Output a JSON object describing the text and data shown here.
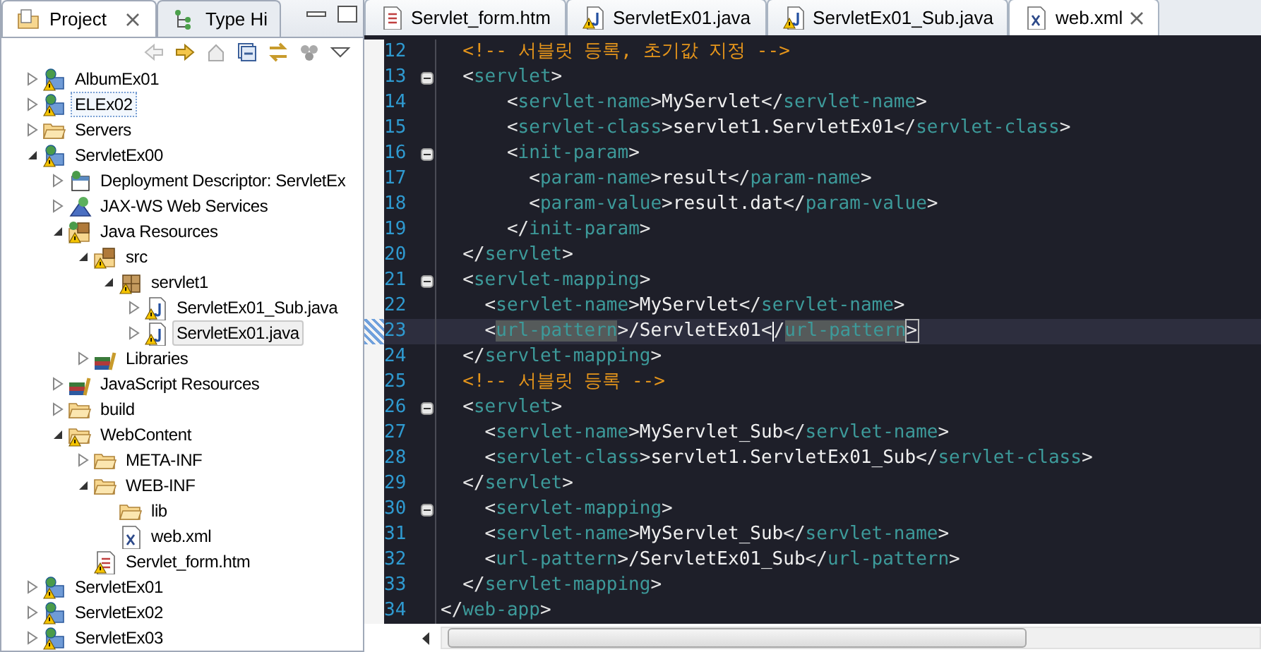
{
  "left_panel": {
    "tabs": [
      {
        "label": "Project",
        "selected": true
      },
      {
        "label": "Type Hi",
        "selected": false
      }
    ],
    "tree": [
      {
        "label": "AlbumEx01",
        "kind": "project",
        "warning": true,
        "expanded": false,
        "selected": false
      },
      {
        "label": "ELEx02",
        "kind": "project",
        "warning": true,
        "expanded": false,
        "selected": false,
        "focused": true
      },
      {
        "label": "Servers",
        "kind": "folder",
        "warning": false,
        "expanded": false,
        "selected": false
      },
      {
        "label": "ServletEx00",
        "kind": "project",
        "warning": true,
        "expanded": true,
        "selected": false,
        "children": [
          {
            "label": "Deployment Descriptor: ServletEx",
            "kind": "descriptor",
            "warning": false,
            "expanded": false,
            "selected": false
          },
          {
            "label": "JAX-WS Web Services",
            "kind": "webservices",
            "warning": false,
            "expanded": false,
            "selected": false
          },
          {
            "label": "Java Resources",
            "kind": "java-resources",
            "warning": true,
            "expanded": true,
            "selected": false,
            "children": [
              {
                "label": "src",
                "kind": "source-folder",
                "warning": true,
                "expanded": true,
                "selected": false,
                "children": [
                  {
                    "label": "servlet1",
                    "kind": "package",
                    "warning": true,
                    "expanded": true,
                    "selected": false,
                    "children": [
                      {
                        "label": "ServletEx01_Sub.java",
                        "kind": "java-file",
                        "warning": true,
                        "expanded": false,
                        "selected": false
                      },
                      {
                        "label": "ServletEx01.java",
                        "kind": "java-file",
                        "warning": true,
                        "expanded": false,
                        "selected": true
                      }
                    ]
                  }
                ]
              },
              {
                "label": "Libraries",
                "kind": "library",
                "warning": false,
                "expanded": false,
                "selected": false
              }
            ]
          },
          {
            "label": "JavaScript Resources",
            "kind": "library",
            "warning": false,
            "expanded": false,
            "selected": false
          },
          {
            "label": "build",
            "kind": "folder",
            "warning": false,
            "expanded": false,
            "selected": false
          },
          {
            "label": "WebContent",
            "kind": "folder",
            "warning": true,
            "expanded": true,
            "selected": false,
            "children": [
              {
                "label": "META-INF",
                "kind": "folder",
                "warning": false,
                "expanded": false,
                "selected": false
              },
              {
                "label": "WEB-INF",
                "kind": "folder",
                "warning": false,
                "expanded": true,
                "selected": false,
                "children": [
                  {
                    "label": "lib",
                    "kind": "folder",
                    "warning": false,
                    "selected": false
                  },
                  {
                    "label": "web.xml",
                    "kind": "xml-file",
                    "warning": false,
                    "selected": false
                  }
                ]
              },
              {
                "label": "Servlet_form.htm",
                "kind": "html-file",
                "warning": true,
                "selected": false
              }
            ]
          }
        ]
      },
      {
        "label": "ServletEx01",
        "kind": "project",
        "warning": true,
        "expanded": false,
        "selected": false
      },
      {
        "label": "ServletEx02",
        "kind": "project",
        "warning": true,
        "expanded": false,
        "selected": false
      },
      {
        "label": "ServletEx03",
        "kind": "project",
        "warning": true,
        "expanded": false,
        "selected": false
      }
    ]
  },
  "editor": {
    "tabs": [
      {
        "label": "Servlet_form.htm",
        "kind": "html-file",
        "warning": false,
        "selected": false
      },
      {
        "label": "ServletEx01.java",
        "kind": "java-file",
        "warning": true,
        "selected": false
      },
      {
        "label": "ServletEx01_Sub.java",
        "kind": "java-file",
        "warning": true,
        "selected": false
      },
      {
        "label": "web.xml",
        "kind": "xml-file",
        "warning": false,
        "selected": true
      }
    ],
    "lines": [
      {
        "number": "12",
        "fold": false,
        "current": false,
        "tokens": [
          {
            "kind": "comment",
            "text": "  <!-- 서블릿 등록, 초기값 지정 -->"
          }
        ]
      },
      {
        "number": "13",
        "fold": true,
        "current": false,
        "tokens": [
          {
            "kind": "punct",
            "text": "  <"
          },
          {
            "kind": "tag",
            "text": "servlet"
          },
          {
            "kind": "punct",
            "text": ">"
          }
        ]
      },
      {
        "number": "14",
        "fold": false,
        "current": false,
        "tokens": [
          {
            "kind": "punct",
            "text": "      <"
          },
          {
            "kind": "tag",
            "text": "servlet-name"
          },
          {
            "kind": "punct",
            "text": ">"
          },
          {
            "kind": "text",
            "text": "MyServlet"
          },
          {
            "kind": "punct",
            "text": "</"
          },
          {
            "kind": "tag",
            "text": "servlet-name"
          },
          {
            "kind": "punct",
            "text": ">"
          }
        ]
      },
      {
        "number": "15",
        "fold": false,
        "current": false,
        "tokens": [
          {
            "kind": "punct",
            "text": "      <"
          },
          {
            "kind": "tag",
            "text": "servlet-class"
          },
          {
            "kind": "punct",
            "text": ">"
          },
          {
            "kind": "text",
            "text": "servlet1.ServletEx01"
          },
          {
            "kind": "punct",
            "text": "</"
          },
          {
            "kind": "tag",
            "text": "servlet-class"
          },
          {
            "kind": "punct",
            "text": ">"
          }
        ]
      },
      {
        "number": "16",
        "fold": true,
        "current": false,
        "tokens": [
          {
            "kind": "punct",
            "text": "      <"
          },
          {
            "kind": "tag",
            "text": "init-param"
          },
          {
            "kind": "punct",
            "text": ">"
          }
        ]
      },
      {
        "number": "17",
        "fold": false,
        "current": false,
        "tokens": [
          {
            "kind": "punct",
            "text": "        <"
          },
          {
            "kind": "tag",
            "text": "param-name"
          },
          {
            "kind": "punct",
            "text": ">"
          },
          {
            "kind": "text",
            "text": "result"
          },
          {
            "kind": "punct",
            "text": "</"
          },
          {
            "kind": "tag",
            "text": "param-name"
          },
          {
            "kind": "punct",
            "text": ">"
          }
        ]
      },
      {
        "number": "18",
        "fold": false,
        "current": false,
        "tokens": [
          {
            "kind": "punct",
            "text": "        <"
          },
          {
            "kind": "tag",
            "text": "param-value"
          },
          {
            "kind": "punct",
            "text": ">"
          },
          {
            "kind": "text",
            "text": "result.dat"
          },
          {
            "kind": "punct",
            "text": "</"
          },
          {
            "kind": "tag",
            "text": "param-value"
          },
          {
            "kind": "punct",
            "text": ">"
          }
        ]
      },
      {
        "number": "19",
        "fold": false,
        "current": false,
        "tokens": [
          {
            "kind": "punct",
            "text": "      </"
          },
          {
            "kind": "tag",
            "text": "init-param"
          },
          {
            "kind": "punct",
            "text": ">"
          }
        ]
      },
      {
        "number": "20",
        "fold": false,
        "current": false,
        "tokens": [
          {
            "kind": "punct",
            "text": "  </"
          },
          {
            "kind": "tag",
            "text": "servlet"
          },
          {
            "kind": "punct",
            "text": ">"
          }
        ]
      },
      {
        "number": "21",
        "fold": true,
        "current": false,
        "tokens": [
          {
            "kind": "punct",
            "text": "  <"
          },
          {
            "kind": "tag",
            "text": "servlet-mapping"
          },
          {
            "kind": "punct",
            "text": ">"
          }
        ]
      },
      {
        "number": "22",
        "fold": false,
        "current": false,
        "tokens": [
          {
            "kind": "punct",
            "text": "    <"
          },
          {
            "kind": "tag",
            "text": "servlet-name"
          },
          {
            "kind": "punct",
            "text": ">"
          },
          {
            "kind": "text",
            "text": "MyServlet"
          },
          {
            "kind": "punct",
            "text": "</"
          },
          {
            "kind": "tag",
            "text": "servlet-name"
          },
          {
            "kind": "punct",
            "text": ">"
          }
        ]
      },
      {
        "number": "23",
        "fold": false,
        "current": true,
        "tokens": [
          {
            "kind": "punct",
            "text": "    <"
          },
          {
            "kind": "tag-marked",
            "text": "url-pattern"
          },
          {
            "kind": "punct",
            "text": ">"
          },
          {
            "kind": "text",
            "text": "/ServletEx01"
          },
          {
            "kind": "punct",
            "text": "<"
          },
          {
            "kind": "caret"
          },
          {
            "kind": "punct",
            "text": "/"
          },
          {
            "kind": "tag-marked",
            "text": "url-pattern"
          },
          {
            "kind": "punct-boxed",
            "text": ">"
          }
        ]
      },
      {
        "number": "24",
        "fold": false,
        "current": false,
        "tokens": [
          {
            "kind": "punct",
            "text": "  </"
          },
          {
            "kind": "tag",
            "text": "servlet-mapping"
          },
          {
            "kind": "punct",
            "text": ">"
          }
        ]
      },
      {
        "number": "25",
        "fold": false,
        "current": false,
        "tokens": [
          {
            "kind": "comment",
            "text": "  <!-- 서블릿 등록 -->"
          }
        ]
      },
      {
        "number": "26",
        "fold": true,
        "current": false,
        "tokens": [
          {
            "kind": "punct",
            "text": "  <"
          },
          {
            "kind": "tag",
            "text": "servlet"
          },
          {
            "kind": "punct",
            "text": ">"
          }
        ]
      },
      {
        "number": "27",
        "fold": false,
        "current": false,
        "tokens": [
          {
            "kind": "punct",
            "text": "    <"
          },
          {
            "kind": "tag",
            "text": "servlet-name"
          },
          {
            "kind": "punct",
            "text": ">"
          },
          {
            "kind": "text",
            "text": "MyServlet_Sub"
          },
          {
            "kind": "punct",
            "text": "</"
          },
          {
            "kind": "tag",
            "text": "servlet-name"
          },
          {
            "kind": "punct",
            "text": ">"
          }
        ]
      },
      {
        "number": "28",
        "fold": false,
        "current": false,
        "tokens": [
          {
            "kind": "punct",
            "text": "    <"
          },
          {
            "kind": "tag",
            "text": "servlet-class"
          },
          {
            "kind": "punct",
            "text": ">"
          },
          {
            "kind": "text",
            "text": "servlet1.ServletEx01_Sub"
          },
          {
            "kind": "punct",
            "text": "</"
          },
          {
            "kind": "tag",
            "text": "servlet-class"
          },
          {
            "kind": "punct",
            "text": ">"
          }
        ]
      },
      {
        "number": "29",
        "fold": false,
        "current": false,
        "tokens": [
          {
            "kind": "punct",
            "text": "  </"
          },
          {
            "kind": "tag",
            "text": "servlet"
          },
          {
            "kind": "punct",
            "text": ">"
          }
        ]
      },
      {
        "number": "30",
        "fold": true,
        "current": false,
        "tokens": [
          {
            "kind": "punct",
            "text": "    <"
          },
          {
            "kind": "tag",
            "text": "servlet-mapping"
          },
          {
            "kind": "punct",
            "text": ">"
          }
        ]
      },
      {
        "number": "31",
        "fold": false,
        "current": false,
        "tokens": [
          {
            "kind": "punct",
            "text": "    <"
          },
          {
            "kind": "tag",
            "text": "servlet-name"
          },
          {
            "kind": "punct",
            "text": ">"
          },
          {
            "kind": "text",
            "text": "MyServlet_Sub"
          },
          {
            "kind": "punct",
            "text": "</"
          },
          {
            "kind": "tag",
            "text": "servlet-name"
          },
          {
            "kind": "punct",
            "text": ">"
          }
        ]
      },
      {
        "number": "32",
        "fold": false,
        "current": false,
        "tokens": [
          {
            "kind": "punct",
            "text": "    <"
          },
          {
            "kind": "tag",
            "text": "url-pattern"
          },
          {
            "kind": "punct",
            "text": ">"
          },
          {
            "kind": "text",
            "text": "/ServletEx01_Sub"
          },
          {
            "kind": "punct",
            "text": "</"
          },
          {
            "kind": "tag",
            "text": "url-pattern"
          },
          {
            "kind": "punct",
            "text": ">"
          }
        ]
      },
      {
        "number": "33",
        "fold": false,
        "current": false,
        "tokens": [
          {
            "kind": "punct",
            "text": "  </"
          },
          {
            "kind": "tag",
            "text": "servlet-mapping"
          },
          {
            "kind": "punct",
            "text": ">"
          }
        ]
      },
      {
        "number": "34",
        "fold": false,
        "current": false,
        "tokens": [
          {
            "kind": "punct",
            "text": "</"
          },
          {
            "kind": "tag",
            "text": "web-app"
          },
          {
            "kind": "punct",
            "text": ">"
          }
        ]
      }
    ]
  }
}
